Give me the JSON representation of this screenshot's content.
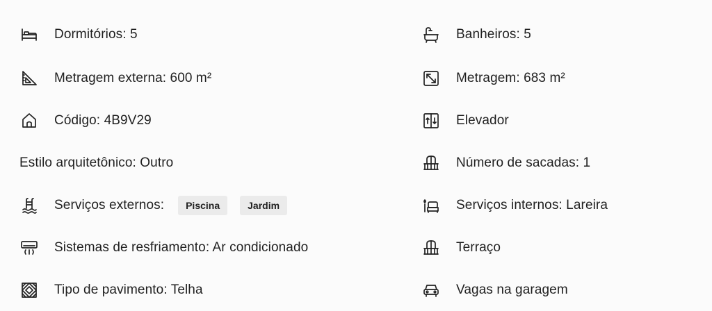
{
  "left": {
    "dormitorios": {
      "label": "Dormitórios: 5",
      "icon": "bed-icon"
    },
    "metragem_externa": {
      "label": "Metragem externa: 600 m²",
      "icon": "set-square-icon"
    },
    "codigo": {
      "label": "Código: 4B9V29",
      "icon": "house-icon"
    },
    "estilo": {
      "label": "Estilo arquitetônico: Outro"
    },
    "servicos_externos": {
      "label": "Serviços externos:",
      "icon": "pool-icon",
      "chips": [
        "Piscina",
        "Jardim"
      ]
    },
    "resfriamento": {
      "label": "Sistemas de resfriamento: Ar condicionado",
      "icon": "air-conditioner-icon"
    },
    "pavimento": {
      "label": "Tipo de pavimento: Telha",
      "icon": "floor-tile-icon"
    }
  },
  "right": {
    "banheiros": {
      "label": "Banheiros: 5",
      "icon": "bathtub-icon"
    },
    "metragem": {
      "label": "Metragem: 683 m²",
      "icon": "expand-arrows-icon"
    },
    "elevador": {
      "label": "Elevador",
      "icon": "elevator-icon"
    },
    "sacadas": {
      "label": "Número de sacadas: 1",
      "icon": "balcony-icon"
    },
    "servicos_internos": {
      "label": "Serviços internos: Lareira",
      "icon": "fireplace-sofa-icon"
    },
    "terraco": {
      "label": "Terraço",
      "icon": "terrace-icon"
    },
    "garagem": {
      "label": "Vagas na garagem",
      "icon": "car-icon"
    }
  }
}
